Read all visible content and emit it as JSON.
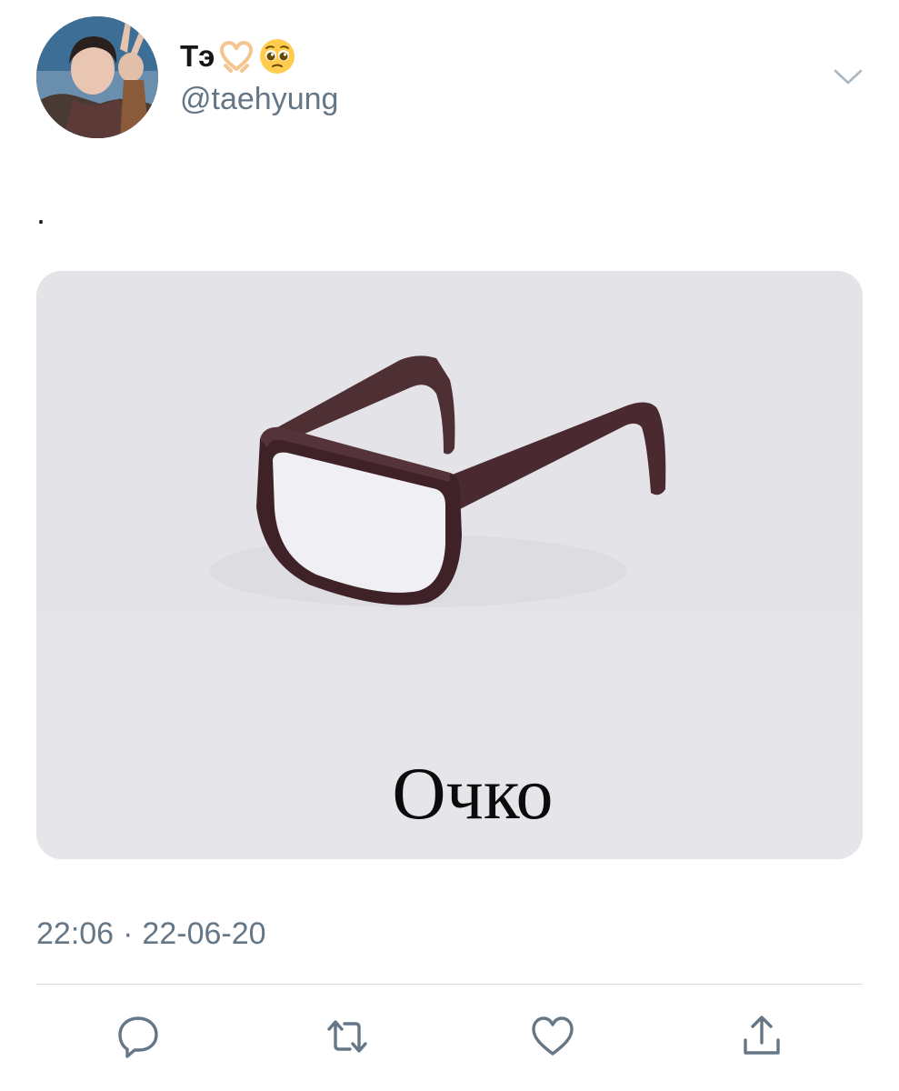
{
  "user": {
    "display_name": "Тэ",
    "name_emojis": [
      "heart-hands-emoji",
      "pleading-face-emoji"
    ],
    "handle": "@taehyung",
    "avatar": "profile-photo"
  },
  "tweet": {
    "text": ".",
    "media": {
      "image": "glasses-photo",
      "caption": "Очко"
    },
    "time": "22:06",
    "separator": "·",
    "date": "22-06-20"
  },
  "actions": {
    "icons": [
      "reply-icon",
      "retweet-icon",
      "like-icon",
      "share-icon"
    ]
  },
  "colors": {
    "text_primary": "#14171a",
    "text_secondary": "#657786",
    "icon": "#657786",
    "divider": "#d6dbe0",
    "media_bg": "#e5e5e8"
  }
}
